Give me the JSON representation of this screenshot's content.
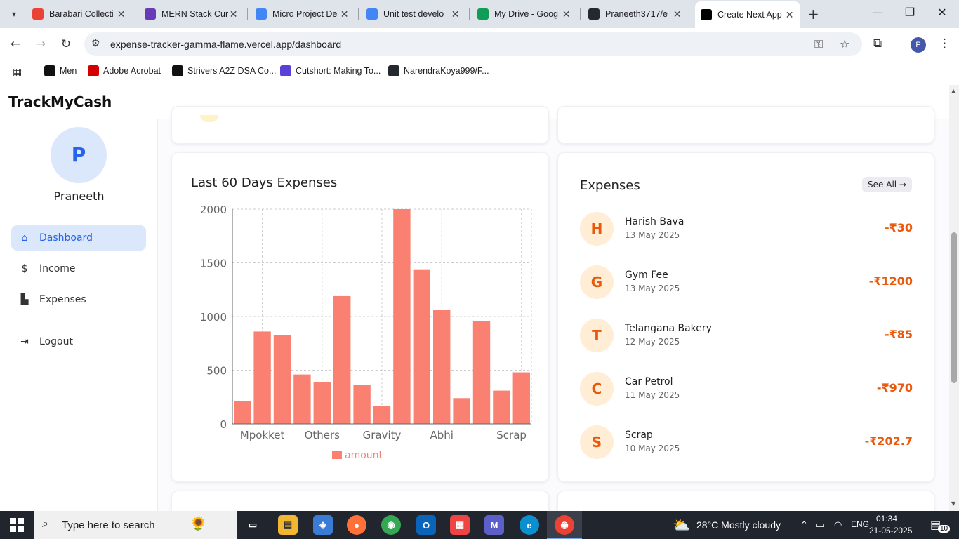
{
  "browser": {
    "tabs": [
      {
        "label": "Barabari Collecti",
        "icon": "gmail-icon",
        "color": "#ea4335"
      },
      {
        "label": "MERN Stack Cur",
        "icon": "forms-icon",
        "color": "#673ab7"
      },
      {
        "label": "Micro Project De",
        "icon": "docs-icon",
        "color": "#4285f4"
      },
      {
        "label": "Unit test develo",
        "icon": "docs-icon",
        "color": "#4285f4"
      },
      {
        "label": "My Drive - Goog",
        "icon": "drive-icon",
        "color": "#0f9d58"
      },
      {
        "label": "Praneeth3717/e",
        "icon": "github-icon",
        "color": "#24292f"
      },
      {
        "label": "Create Next App",
        "icon": "nextjs-icon",
        "color": "#000000"
      }
    ],
    "url": "expense-tracker-gamma-flame.vercel.app/dashboard",
    "profile_initial": "P",
    "bookmarks": [
      {
        "label": "Men",
        "icon": "amazon-icon"
      },
      {
        "label": "Adobe Acrobat",
        "icon": "acrobat-icon"
      },
      {
        "label": "Strivers A2Z DSA Co...",
        "icon": "tuf-icon"
      },
      {
        "label": "Cutshort: Making To...",
        "icon": "cutshort-icon"
      },
      {
        "label": "NarendraKoya999/F...",
        "icon": "github-icon"
      }
    ]
  },
  "app": {
    "brand": "TrackMyCash",
    "user": {
      "initial": "P",
      "name": "Praneeth"
    },
    "nav": [
      {
        "label": "Dashboard",
        "icon": "home-icon",
        "active": true
      },
      {
        "label": "Income",
        "icon": "dollar-icon",
        "active": false
      },
      {
        "label": "Expenses",
        "icon": "chart-icon",
        "active": false
      },
      {
        "label": "Logout",
        "icon": "logout-icon",
        "active": false
      }
    ],
    "chart_card": {
      "title": "Last 60 Days Expenses"
    },
    "expenses_card": {
      "title": "Expenses",
      "see_all": "See All →",
      "items": [
        {
          "initial": "H",
          "name": "Harish Bava",
          "date": "13 May 2025",
          "amount": "-₹30"
        },
        {
          "initial": "G",
          "name": "Gym Fee",
          "date": "13 May 2025",
          "amount": "-₹1200"
        },
        {
          "initial": "T",
          "name": "Telangana Bakery",
          "date": "12 May 2025",
          "amount": "-₹85"
        },
        {
          "initial": "C",
          "name": "Car Petrol",
          "date": "11 May 2025",
          "amount": "-₹970"
        },
        {
          "initial": "S",
          "name": "Scrap",
          "date": "10 May 2025",
          "amount": "-₹202.7"
        }
      ]
    }
  },
  "chart_data": {
    "type": "bar",
    "title": "Last 60 Days Expenses",
    "x_tick_labels": [
      "Mpokket",
      "Others",
      "Gravity",
      "Abhi",
      "Scrap"
    ],
    "values": [
      210,
      860,
      830,
      460,
      390,
      1190,
      360,
      170,
      2000,
      1440,
      1060,
      240,
      960,
      310,
      480
    ],
    "ylim": [
      0,
      2000
    ],
    "y_ticks": [
      0,
      500,
      1000,
      1500,
      2000
    ],
    "series_name": "amount",
    "bar_color": "#fa8072",
    "legend_position": "bottom",
    "grid": true
  },
  "taskbar": {
    "search_placeholder": "Type here to search",
    "weather": "28°C  Mostly cloudy",
    "lang": "ENG",
    "time": "01:34",
    "date": "21-05-2025",
    "notifications": "10"
  }
}
